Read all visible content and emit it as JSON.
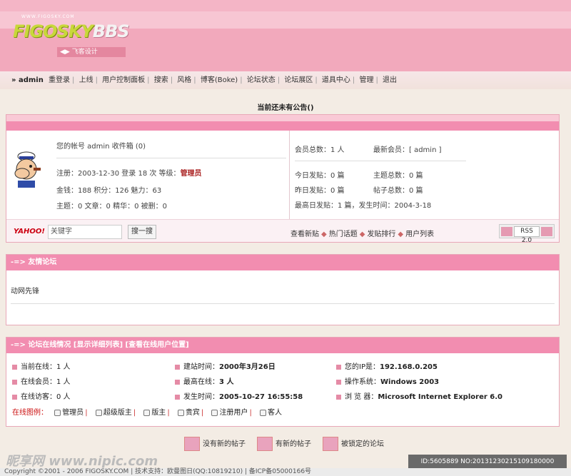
{
  "header": {
    "small_url": "WWW.FIGOSKY.COM",
    "logo_part1": "FIGOSKY",
    "logo_part2": "BBS",
    "subtitle": "◀▶ 飞客设计"
  },
  "nav": {
    "user": "» admin",
    "items": [
      "重登录",
      "上线",
      "用户控制面板",
      "搜索",
      "风格",
      "博客(Boke)",
      "论坛状态",
      "论坛展区",
      "道具中心",
      "管理",
      "退出"
    ]
  },
  "announcement": "当前还未有公告()",
  "user_panel": {
    "account": "您的帐号 admin 收件箱 (0)",
    "reg": "注册：2003-12-30 登录 18 次 等级：",
    "reg_level": "管理员",
    "money": "金钱：188 积分：126 魅力：63",
    "posts": "主题：0 文章：0 精华：0 被删：0",
    "stats": {
      "members": "会员总数：1 人",
      "newest": "最新会员：[ admin ]",
      "today": "今日发贴：0 篇",
      "topics": "主题总数：0 篇",
      "yesterday": "昨日发贴：0 篇",
      "posts_total": "帖子总数：0 篇",
      "max": "最高日发贴：1 篇，发生时间：2004-3-18"
    },
    "search": {
      "yahoo": "YAHOO!",
      "placeholder": "关键字",
      "button": "搜一搜"
    },
    "links": [
      "查看新贴",
      "热门话题",
      "发贴排行",
      "用户列表"
    ],
    "rss": "RSS 2.0"
  },
  "friend_panel": {
    "title": "-=> 友情论坛",
    "content": "动网先锋"
  },
  "online_panel": {
    "title": "-=> 论坛在线情况 [显示详细列表] [查看在线用户位置]",
    "cells": {
      "current": "当前在线：1 人",
      "build_label": "建站时间：",
      "build_value": "2000年3月26日",
      "ip_label": "您的IP是：",
      "ip_value": "192.168.0.205",
      "online_members": "在线会员：1 人",
      "max_label": "最高在线：",
      "max_value": "3 人",
      "os_label": "操作系统：",
      "os_value": "Windows 2003",
      "guests": "在线访客：0 人",
      "occur_label": "发生时间：",
      "occur_value": "2005-10-27 16:55:58",
      "browser_label": "浏 览 器：",
      "browser_value": "Microsoft Internet Explorer 6.0"
    },
    "legend": {
      "label": "在线图例：",
      "items": [
        "管理员",
        "超级版主",
        "版主",
        "贵宾",
        "注册用户",
        "客人"
      ]
    }
  },
  "bottom_legend": [
    "没有新的帖子",
    "有新的帖子",
    "被锁定的论坛"
  ],
  "footer": "Copyright ©2001 - 2006 FIGOSKY.COM | 技术支持：欧曼图日(QQ:10819210) | 备ICP备05000166号",
  "watermark": {
    "left": "昵享网 www.nipic.com",
    "right": "ID:5605889 NO:20131230215109180000"
  }
}
